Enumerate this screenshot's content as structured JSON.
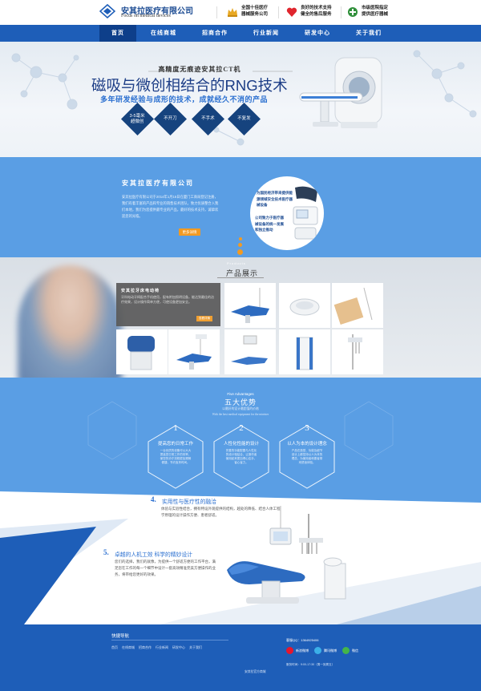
{
  "header": {
    "brand_cn": "安其拉医疗有限公司",
    "brand_en": "Focus on medical devices",
    "features": [
      {
        "icon": "crown-icon",
        "line1": "全国十佳医疗",
        "line2": "器械服务公司"
      },
      {
        "icon": "heart-icon",
        "line1": "良好的技术支持",
        "line2": "健全的售后服务"
      },
      {
        "icon": "hospital-icon",
        "line1": "市级医院指定",
        "line2": "提供医疗器械"
      }
    ]
  },
  "nav": {
    "items": [
      "首页",
      "在线商城",
      "招商合作",
      "行业新闻",
      "研发中心",
      "关于我们"
    ],
    "active_index": 0
  },
  "hero": {
    "subtitle": "高精度无痕迹安其拉CT机",
    "title": "磁吸与微创相结合的RNG技术",
    "slogan": "多年研发经验与成形的技术，成就经久不消的产品",
    "badges": [
      "3-5毫米\n超微创",
      "不开刀",
      "不手术",
      "不复发"
    ]
  },
  "intro": {
    "title": "安其拉医疗有限公司",
    "text": "安其拉医疗有限公司于2014年1月16日在厦门工商局登记注册，我们有着丰富的产品和专业的销售技术团队，致力优质整合入我们本地，我们为您提供最专业的产品，最好的技术支持，诚挚欢迎您的光临。",
    "button": "更多详情",
    "circle_left": "为国民经济带来提供能源领域安全技术医疗器械设备",
    "circle_right": "公司致力于医疗器械设备的统一发展和独立推动"
  },
  "products": {
    "en": "Products",
    "cn": "产品展示",
    "tile_title": "安其拉牙床电动椅",
    "tile_text": "牙科电动牙椅配合手机使用，配有附加照明设备，能达到最佳的治疗效果，设计操作简单方便，可使设备更加安全。",
    "tile_button": "查看详情"
  },
  "advantages": {
    "en": "Five Advantages",
    "cn": "五大优势",
    "sub": "以最好的设计最超值的价格",
    "sub2": "With the best medical equipment for the minister",
    "cards": [
      {
        "num": "1",
        "title": "提高您的日常工作",
        "text": "一台优质的设备可以大大提高您日常工作的效率，使您的诊疗流程更加顺畅便捷，节约宝贵时间。"
      },
      {
        "num": "2",
        "title": "人性化性能的设计",
        "text": "完善的功能配置与人性化的设计相结合，让操作者使用起来更加得心应手，省心省力。"
      },
      {
        "num": "3",
        "title": "以人为本的设计理念",
        "text": "产品在造型、功能及细节设计上都坚持以人为本的理念，为使用者和患者带来舒适体验。"
      }
    ]
  },
  "features": [
    {
      "num": "4.",
      "title": "实用性与医疗性的融洽",
      "text": "体验与实验性结合，拥有特设外观提供的结构，越处的降低、结合人体工程学原理的设计操作方便、患者舒适。"
    },
    {
      "num": "5.",
      "title": "卓越的人机工效   科学的精妙设计",
      "text": "您们的选择，我们的就像，为提供一个舒适方便的工作平台，满足您在工作的每一个细节中设计一套高效精准完美方便操作的业务，将带给您更好的效果。"
    }
  ],
  "footer": {
    "quick_nav_title": "快捷导航",
    "quick_links": [
      "首页",
      "在线商城",
      "招商合作",
      "行业新闻",
      "研发中心",
      "关于我们"
    ],
    "bottom_text": "安其拉官方商城",
    "qq": "客服QQ：1364925406",
    "social": [
      {
        "icon": "weibo-icon",
        "label": "新浪微博",
        "color": "#e6162d"
      },
      {
        "icon": "tencent-weibo-icon",
        "label": "腾讯微博",
        "color": "#3bb0e8"
      },
      {
        "icon": "wechat-icon",
        "label": "微信",
        "color": "#44b549"
      }
    ],
    "hours": "服务时间：9:00-17:30（周一到周五）"
  },
  "colors": {
    "primary": "#1e5eb8",
    "light_blue": "#5a9ee4",
    "navy": "#16437e",
    "accent": "#f29a22"
  }
}
